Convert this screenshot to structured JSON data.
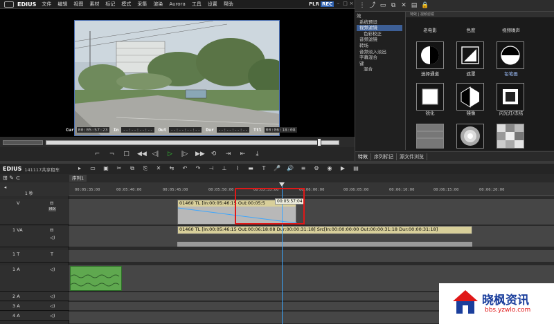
{
  "app": {
    "brand": "EDIUS",
    "plr": "PLR",
    "rec": "REC"
  },
  "menu": [
    "文件",
    "编辑",
    "视图",
    "素材",
    "标记",
    "模式",
    "采集",
    "渲染",
    "Aurora",
    "工具",
    "设置",
    "帮助"
  ],
  "player": {
    "cur_label": "Cur",
    "cur_value": "00:05:57:23",
    "in_label": "In",
    "in_value": "--:--:--:--",
    "out_label": "Out",
    "out_value": "--:--:--:--",
    "dur_label": "Dur",
    "dur_value": "--:--:--:--",
    "ttl_label": "Ttl",
    "ttl_value": "00:06:18:08"
  },
  "palette": {
    "tree": [
      "效",
      "系统预设",
      "视频滤镜",
      "色彩校正",
      "音频滤镜",
      "转场",
      "音频淡入淡出",
      "字幕混合",
      "键",
      "混合"
    ],
    "tree_selected_index": 2,
    "grid_header": "特效 | 视频滤镜",
    "tiles": [
      {
        "label": "老电影",
        "icon": "old-film-icon"
      },
      {
        "label": "色度",
        "icon": "chroma-icon"
      },
      {
        "label": "视频噪声",
        "icon": "video-noise-icon"
      },
      {
        "label": "选择通道",
        "icon": "select-channel-icon"
      },
      {
        "label": "遮罩",
        "icon": "mask-icon"
      },
      {
        "label": "铅笔画",
        "icon": "pencil-sketch-icon",
        "selected": true
      },
      {
        "label": "锐化",
        "icon": "sharpen-icon"
      },
      {
        "label": "镜像",
        "icon": "mirror-icon"
      },
      {
        "label": "闪光灯/冻结",
        "icon": "strobe-icon"
      }
    ],
    "tabs": [
      "特效",
      "序列标记",
      "源文件浏览"
    ]
  },
  "timeline": {
    "brand": "EDIUS",
    "project": "141117共享租车",
    "sequence_tab": "序列1",
    "ruler": [
      "00:05:35:00",
      "00:05:40:00",
      "00:05:45:00",
      "00:05:50:00",
      "00:05:55:00",
      "00:06:00:00",
      "00:06:05:00",
      "00:06:10:00",
      "00:06:15:00",
      "00:06:20:00"
    ],
    "tracks": [
      {
        "name": "V",
        "type": "video"
      },
      {
        "name": "1 VA",
        "type": "video-audio"
      },
      {
        "name": "1 T",
        "type": "title"
      },
      {
        "name": "1 A",
        "type": "audio"
      },
      {
        "name": "2 A",
        "type": "audio"
      },
      {
        "name": "3 A",
        "type": "audio"
      },
      {
        "name": "4 A",
        "type": "audio"
      }
    ],
    "header_zoom": "1 秒",
    "mix_label": "MIX",
    "clip_v": "01460  TL [In:00:05:46:15 Out:00:05:5",
    "clip_va": "01460  TL [In:00:05:46:15 Out:00:06:18:08 Dur:00:00:31:18]  Src[In:00:00:00:00 Out:00:00:31:18 Dur:00:00:31:18]",
    "playhead_tc": "00:05:57:04"
  },
  "watermark": {
    "title": "晓枫资讯",
    "url": "bbs.yzwlo.com"
  },
  "colors": {
    "accent": "#3d5f96",
    "playhead": "#3aa6ff",
    "highlight": "#e01818",
    "audio_clip": "#5fa84f",
    "clip_label": "#d8cf9a"
  }
}
